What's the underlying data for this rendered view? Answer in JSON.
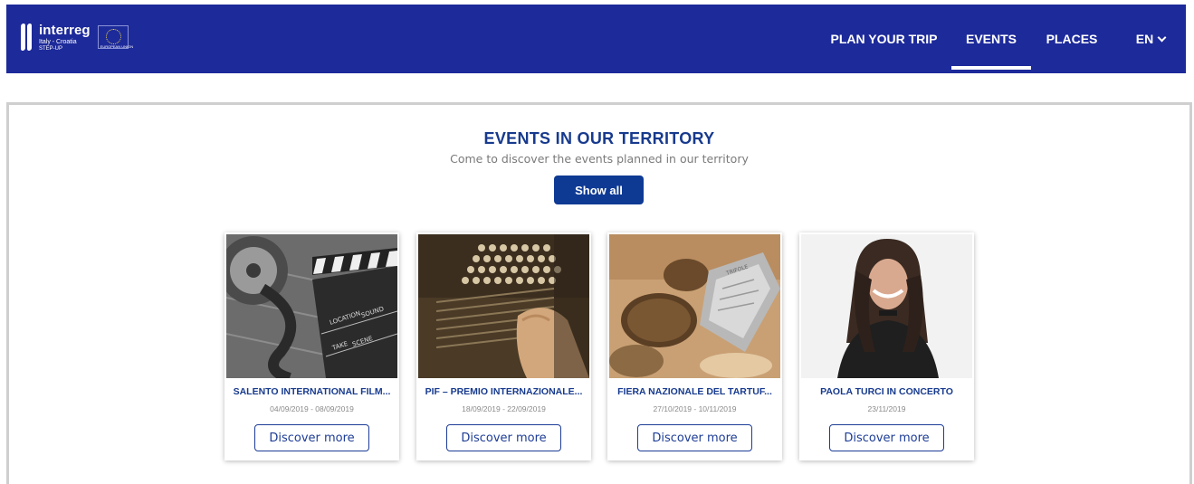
{
  "nav": {
    "logo": {
      "brand": "interreg",
      "sub": "Italy - Croatia",
      "sub2": "STEP-UP",
      "eu_label": "EUROPEAN UNION"
    },
    "items": [
      {
        "label": "PLAN YOUR TRIP"
      },
      {
        "label": "EVENTS",
        "active": true
      },
      {
        "label": "PLACES"
      }
    ],
    "language": "EN",
    "icons": {
      "language": "chevron-down-icon",
      "eu": "eu-flag-icon"
    }
  },
  "events_section": {
    "title": "EVENTS IN OUR TERRITORY",
    "subtitle": "Come to discover the events planned in our territory",
    "show_all_label": "Show all"
  },
  "events": [
    {
      "title": "SALENTO INTERNATIONAL FILM...",
      "date": "04/09/2019 - 08/09/2019",
      "button": "Discover more",
      "image": "film-clapperboard"
    },
    {
      "title": "PIF – PREMIO INTERNAZIONALE...",
      "date": "18/09/2019 - 22/09/2019",
      "button": "Discover more",
      "image": "accordion"
    },
    {
      "title": "FIERA NAZIONALE DEL TARTUF...",
      "date": "27/10/2019 - 10/11/2019",
      "button": "Discover more",
      "image": "truffles"
    },
    {
      "title": "PAOLA TURCI IN CONCERTO",
      "date": "23/11/2019",
      "button": "Discover more",
      "image": "singer-portrait"
    }
  ],
  "colors": {
    "navbar": "#1d2a9a",
    "title": "#173a8e",
    "primary_button": "#0e3a94",
    "panel_border": "#cfcfcf"
  }
}
